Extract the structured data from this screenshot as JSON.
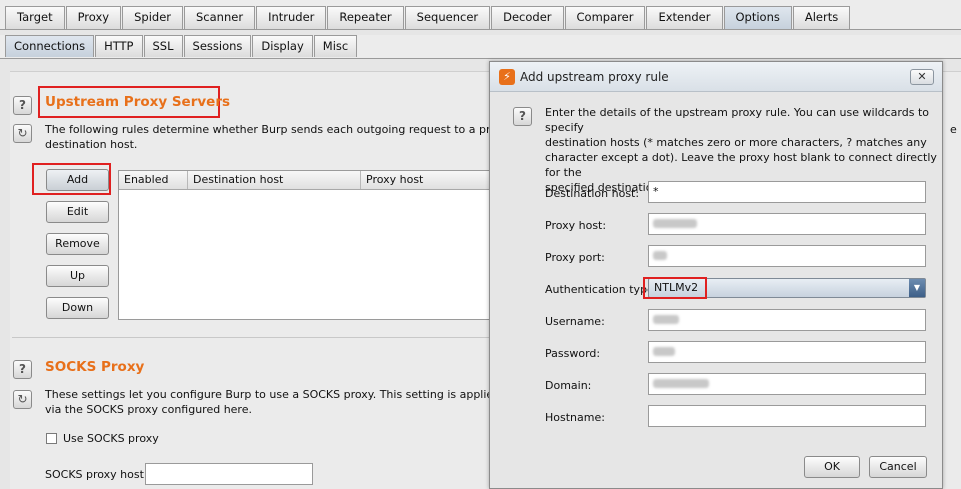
{
  "main_tabs": [
    {
      "label": "Target"
    },
    {
      "label": "Proxy"
    },
    {
      "label": "Spider"
    },
    {
      "label": "Scanner"
    },
    {
      "label": "Intruder"
    },
    {
      "label": "Repeater"
    },
    {
      "label": "Sequencer"
    },
    {
      "label": "Decoder"
    },
    {
      "label": "Comparer"
    },
    {
      "label": "Extender"
    },
    {
      "label": "Options",
      "active": true
    },
    {
      "label": "Alerts"
    }
  ],
  "sub_tabs": [
    {
      "label": "Connections",
      "active": true
    },
    {
      "label": "HTTP"
    },
    {
      "label": "SSL"
    },
    {
      "label": "Sessions"
    },
    {
      "label": "Display"
    },
    {
      "label": "Misc"
    }
  ],
  "upstream": {
    "title": "Upstream Proxy Servers",
    "desc_line1": "The following rules determine whether Burp sends each outgoing request to a proxy server",
    "desc_line2": "destination host.",
    "desc_tail": "e",
    "buttons": {
      "add": "Add",
      "edit": "Edit",
      "remove": "Remove",
      "up": "Up",
      "down": "Down"
    },
    "columns": [
      "Enabled",
      "Destination host",
      "Proxy host"
    ]
  },
  "socks": {
    "title": "SOCKS Proxy",
    "desc_line1": "These settings let you configure Burp to use a SOCKS proxy. This setting is applied at the TC",
    "desc_line2": "via the SOCKS proxy configured here.",
    "checkbox_label": "Use SOCKS proxy",
    "host_label": "SOCKS proxy host:"
  },
  "dialog": {
    "title": "Add upstream proxy rule",
    "close": "✕",
    "help_lines": [
      "Enter the details of the upstream proxy rule. You can use wildcards to specify",
      "destination hosts (* matches zero or more characters, ? matches any",
      "character except a dot). Leave the proxy host blank to connect directly for the",
      "specified destination host."
    ],
    "fields": {
      "destination_host": {
        "label": "Destination host:",
        "value": "*"
      },
      "proxy_host": {
        "label": "Proxy host:"
      },
      "proxy_port": {
        "label": "Proxy port:"
      },
      "auth_type": {
        "label": "Authentication type:",
        "value": "NTLMv2"
      },
      "username": {
        "label": "Username:"
      },
      "password": {
        "label": "Password:"
      },
      "domain": {
        "label": "Domain:"
      },
      "hostname": {
        "label": "Hostname:",
        "value": ""
      }
    },
    "ok": "OK",
    "cancel": "Cancel"
  },
  "colors": {
    "accent": "#e8701a",
    "highlight": "#e02020"
  },
  "icons": {
    "help": "help-icon",
    "refresh": "refresh-icon",
    "app": "burp-icon",
    "close": "close-icon",
    "dropdown": "chevron-down-icon"
  }
}
